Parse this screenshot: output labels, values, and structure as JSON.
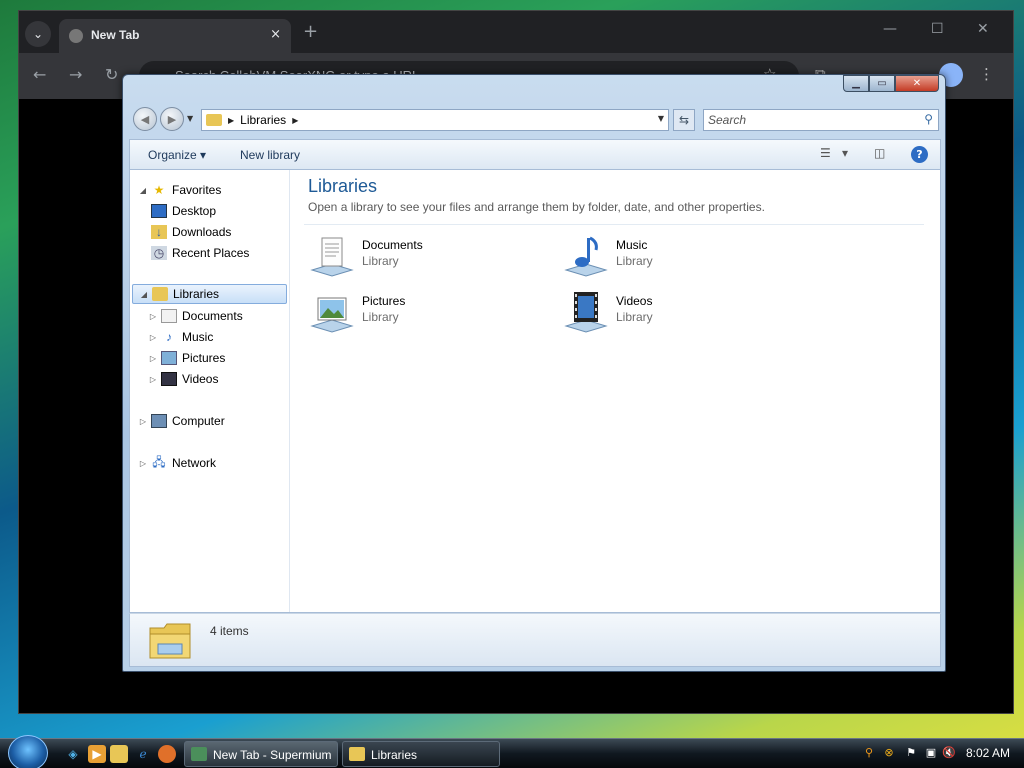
{
  "browser": {
    "tab_title": "New Tab",
    "tab_close_glyph": "×",
    "new_tab_glyph": "+",
    "omnibox_placeholder": "Search CollabVM SearXNG or type a URL",
    "window_controls": [
      "—",
      "☐",
      "✕"
    ]
  },
  "explorer": {
    "breadcrumb": "Libraries",
    "search_placeholder": "Search",
    "toolbar": {
      "organize_label": "Organize",
      "new_library_label": "New library"
    },
    "nav_tree": [
      {
        "label": "Favorites",
        "icon": "star-icon"
      },
      {
        "label": "Desktop",
        "icon": "desktop-icon"
      },
      {
        "label": "Downloads",
        "icon": "downloads-icon"
      },
      {
        "label": "Recent Places",
        "icon": "recent-places-icon"
      },
      {
        "label": "Libraries",
        "icon": "libraries-icon"
      },
      {
        "label": "Documents",
        "icon": "documents-icon"
      },
      {
        "label": "Music",
        "icon": "music-icon"
      },
      {
        "label": "Pictures",
        "icon": "pictures-icon"
      },
      {
        "label": "Videos",
        "icon": "videos-icon"
      },
      {
        "label": "Computer",
        "icon": "computer-icon"
      },
      {
        "label": "Network",
        "icon": "network-icon"
      }
    ],
    "content": {
      "title": "Libraries",
      "subtitle": "Open a library to see your files and arrange them by folder, date, and other properties.",
      "libraries": [
        {
          "name": "Documents",
          "type": "Library",
          "icon": "documents-library-icon"
        },
        {
          "name": "Music",
          "type": "Library",
          "icon": "music-library-icon"
        },
        {
          "name": "Pictures",
          "type": "Library",
          "icon": "pictures-library-icon"
        },
        {
          "name": "Videos",
          "type": "Library",
          "icon": "videos-library-icon"
        }
      ]
    },
    "details": {
      "item_count": "4 items"
    }
  },
  "taskbar": {
    "buttons": [
      {
        "label": "New Tab - Supermium"
      },
      {
        "label": "Libraries"
      }
    ],
    "clock": "8:02 AM"
  }
}
